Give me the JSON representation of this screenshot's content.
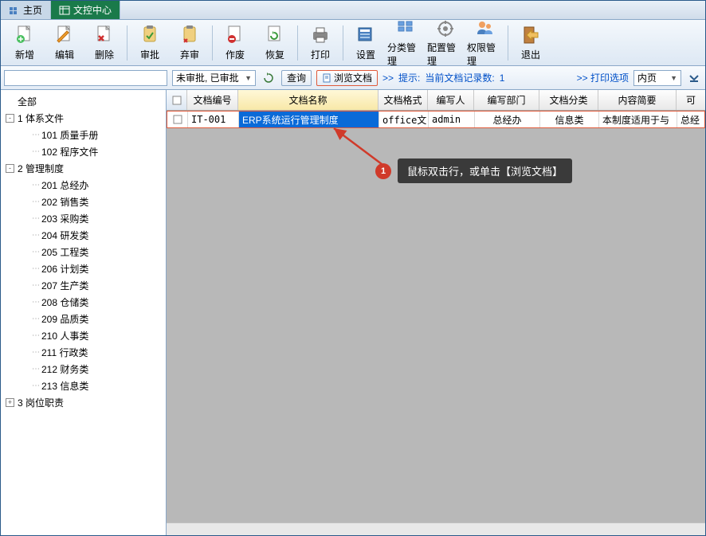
{
  "tabs": {
    "home": "主页",
    "doc_center": "文控中心"
  },
  "toolbar": {
    "new": "新增",
    "edit": "编辑",
    "delete": "删除",
    "approve": "审批",
    "reject": "弃审",
    "void": "作废",
    "restore": "恢复",
    "print": "打印",
    "settings": "设置",
    "category": "分类管理",
    "config": "配置管理",
    "permission": "权限管理",
    "exit": "退出"
  },
  "filter": {
    "status": "未审批, 已审批",
    "query": "查询",
    "browse": "浏览文档",
    "hint_label": "提示:",
    "hint_text": "当前文档记录数:",
    "hint_count": "1",
    "print_options": "打印选项",
    "print_sel": "内页"
  },
  "tree": [
    {
      "label": "全部",
      "level": 0,
      "exp": null
    },
    {
      "label": "1 体系文件",
      "level": 0,
      "exp": "-"
    },
    {
      "label": "101 质量手册",
      "level": 1,
      "exp": null
    },
    {
      "label": "102 程序文件",
      "level": 1,
      "exp": null
    },
    {
      "label": "2 管理制度",
      "level": 0,
      "exp": "-"
    },
    {
      "label": "201 总经办",
      "level": 1,
      "exp": null
    },
    {
      "label": "202 销售类",
      "level": 1,
      "exp": null
    },
    {
      "label": "203 采购类",
      "level": 1,
      "exp": null
    },
    {
      "label": "204 研发类",
      "level": 1,
      "exp": null
    },
    {
      "label": "205 工程类",
      "level": 1,
      "exp": null
    },
    {
      "label": "206 计划类",
      "level": 1,
      "exp": null
    },
    {
      "label": "207 生产类",
      "level": 1,
      "exp": null
    },
    {
      "label": "208 仓储类",
      "level": 1,
      "exp": null
    },
    {
      "label": "209 品质类",
      "level": 1,
      "exp": null
    },
    {
      "label": "210 人事类",
      "level": 1,
      "exp": null
    },
    {
      "label": "211 行政类",
      "level": 1,
      "exp": null
    },
    {
      "label": "212 财务类",
      "level": 1,
      "exp": null
    },
    {
      "label": "213 信息类",
      "level": 1,
      "exp": null
    },
    {
      "label": "3 岗位职责",
      "level": 0,
      "exp": "+"
    }
  ],
  "grid": {
    "headers": {
      "code": "文档编号",
      "name": "文档名称",
      "format": "文档格式",
      "author": "编写人",
      "dept": "编写部门",
      "category": "文档分类",
      "summary": "内容简要",
      "more": "可"
    },
    "row": {
      "code": "IT-001",
      "name": "ERP系统运行管理制度",
      "format": "office文",
      "author": "admin",
      "dept": "总经办",
      "category": "信息类",
      "summary": "本制度适用于与",
      "more": "总经"
    }
  },
  "callout": {
    "num": "1",
    "text": "鼠标双击行，或单击【浏览文档】"
  }
}
